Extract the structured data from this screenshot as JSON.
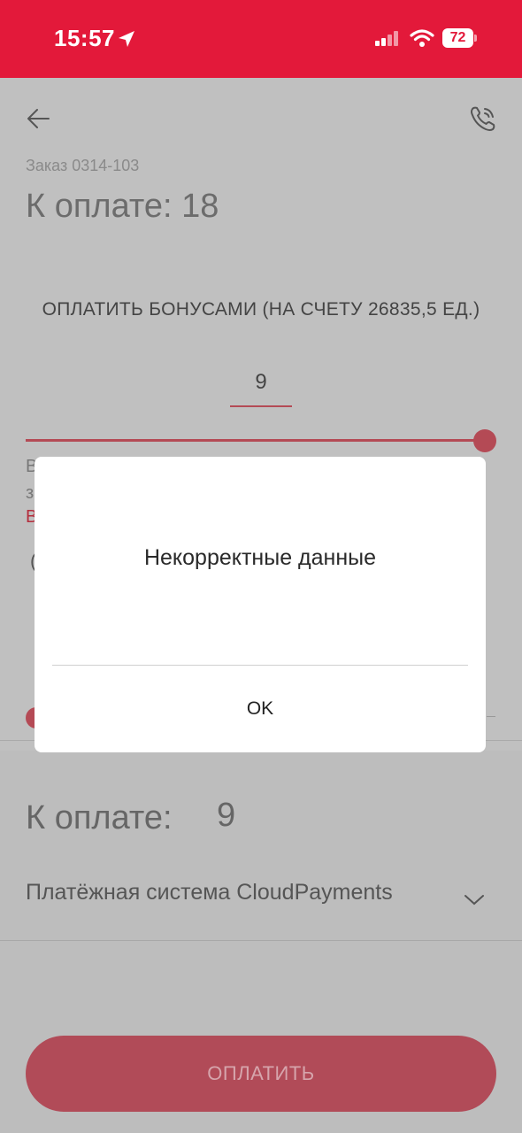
{
  "status_bar": {
    "time": "15:57",
    "battery": "72",
    "icons": [
      "location-arrow-icon",
      "signal-icon",
      "wifi-icon",
      "battery-icon"
    ]
  },
  "header": {
    "order_label": "Заказ 0314-103",
    "to_pay_title": "К оплате: 18"
  },
  "bonus": {
    "title": "ОПЛАТИТЬ БОНУСАМИ (НА СЧЕТУ 26835,5 ЕД.)",
    "input_value": "9",
    "slider_level": 1.0
  },
  "obscured_fragments": {
    "line1": "В",
    "line2": "з",
    "line3_red": "В",
    "paren_left": "(",
    "paren_right": ")"
  },
  "summary": {
    "to_pay_label": "К оплате:",
    "to_pay_value": "9",
    "payment_system": "Платёжная система CloudPayments"
  },
  "pay_button_label": "ОПЛАТИТЬ",
  "dialog": {
    "message": "Некорректные данные",
    "ok_label": "OK"
  },
  "colors": {
    "status_bar": "#e3193a",
    "accent": "#b44a55",
    "overlay_background": "#c0c0c0",
    "dialog_background": "#ffffff"
  }
}
